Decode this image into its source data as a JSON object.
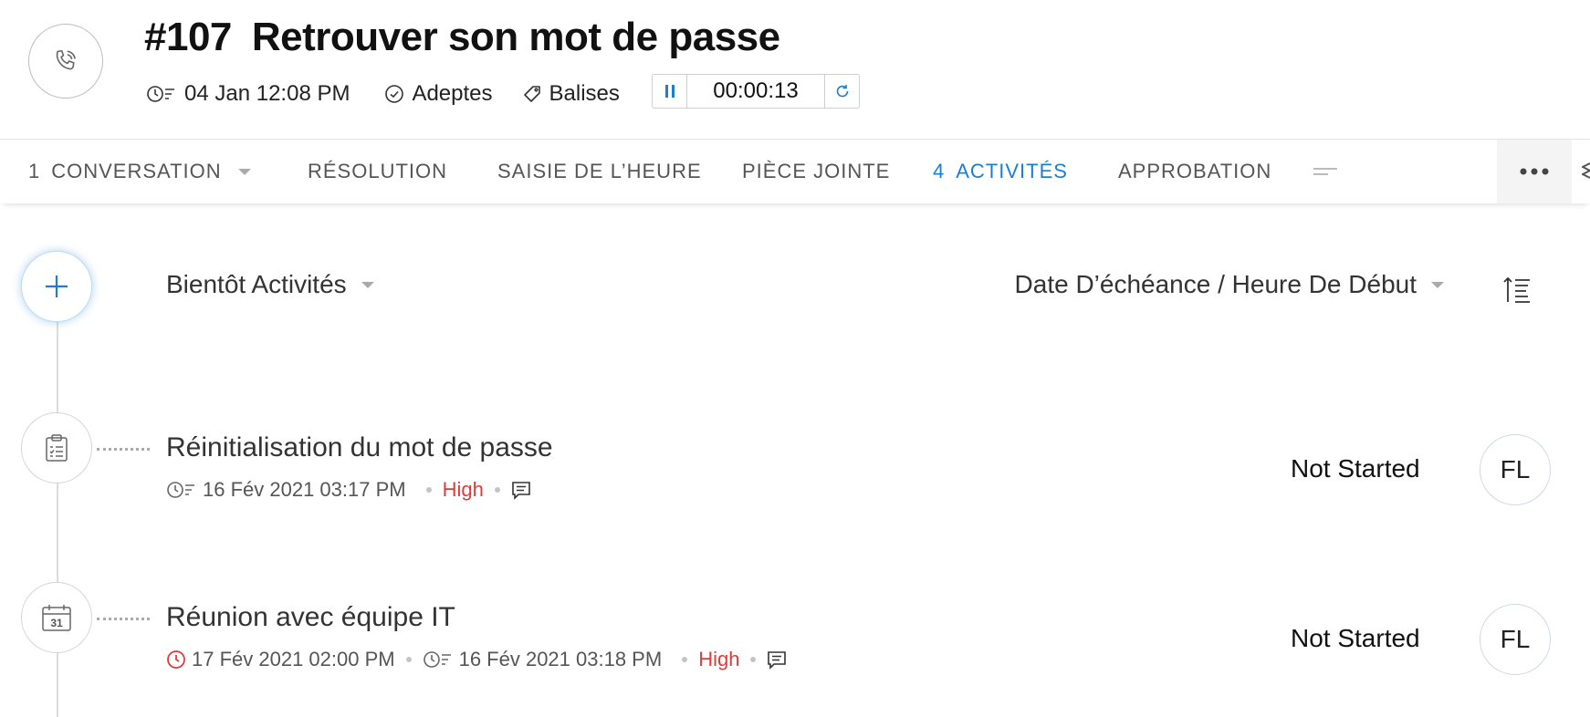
{
  "ticket": {
    "number": "#107",
    "title": "Retrouver son mot de passe",
    "created": "04 Jan 12:08 PM",
    "follow_label": "Adeptes",
    "tags_label": "Balises",
    "timer": "00:00:13"
  },
  "tabs": [
    {
      "count": "1",
      "label": "CONVERSATION"
    },
    {
      "count": "",
      "label": "RÉSOLUTION"
    },
    {
      "count": "",
      "label": "SAISIE DE L’HEURE"
    },
    {
      "count": "",
      "label": "PIÈCE JOINTE"
    },
    {
      "count": "4",
      "label": "ACTIVITÉS"
    },
    {
      "count": "",
      "label": "APPROBATION"
    }
  ],
  "toolbar": {
    "filter_label": "Bientôt Activités",
    "sort_label": "Date D’échéance / Heure De Début"
  },
  "activities": [
    {
      "title": "Réinitialisation du mot de passe",
      "created": "16 Fév 2021 03:17 PM",
      "priority": "High",
      "status": "Not Started",
      "assignee": "FL",
      "icon": "task-icon"
    },
    {
      "title": "Réunion avec équipe IT",
      "due": "17 Fév 2021 02:00 PM",
      "created": "16 Fév 2021 03:18 PM",
      "priority": "High",
      "status": "Not Started",
      "assignee": "FL",
      "icon": "calendar-icon",
      "calendar_day": "31"
    }
  ],
  "colors": {
    "accent": "#1a7fd4",
    "priority_high": "#e23b3b"
  }
}
